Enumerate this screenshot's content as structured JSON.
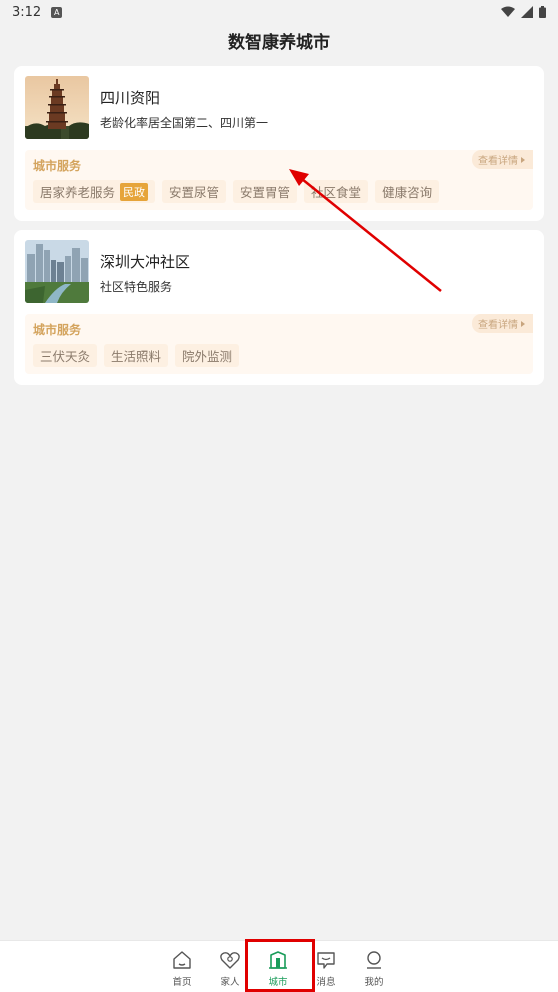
{
  "status": {
    "time": "3:12",
    "app_icon_letter": "A"
  },
  "header": {
    "title": "数智康养城市"
  },
  "cities": [
    {
      "name": "四川资阳",
      "description": "老龄化率居全国第二、四川第一",
      "service_title": "城市服务",
      "detail_label": "查看详情",
      "tags": [
        {
          "label": "居家养老服务",
          "badge": "民政"
        },
        {
          "label": "安置尿管"
        },
        {
          "label": "安置胃管"
        },
        {
          "label": "社区食堂"
        },
        {
          "label": "健康咨询"
        }
      ]
    },
    {
      "name": "深圳大冲社区",
      "description": "社区特色服务",
      "service_title": "城市服务",
      "detail_label": "查看详情",
      "tags": [
        {
          "label": "三伏天灸"
        },
        {
          "label": "生活照料"
        },
        {
          "label": "院外监测"
        }
      ]
    }
  ],
  "tabbar": {
    "home": "首页",
    "family": "家人",
    "city": "城市",
    "message": "消息",
    "mine": "我的",
    "active": "city"
  },
  "colors": {
    "accent": "#1a9c5a",
    "service_title": "#d4a45e",
    "badge": "#e6a43a",
    "annotation": "#e00000"
  }
}
